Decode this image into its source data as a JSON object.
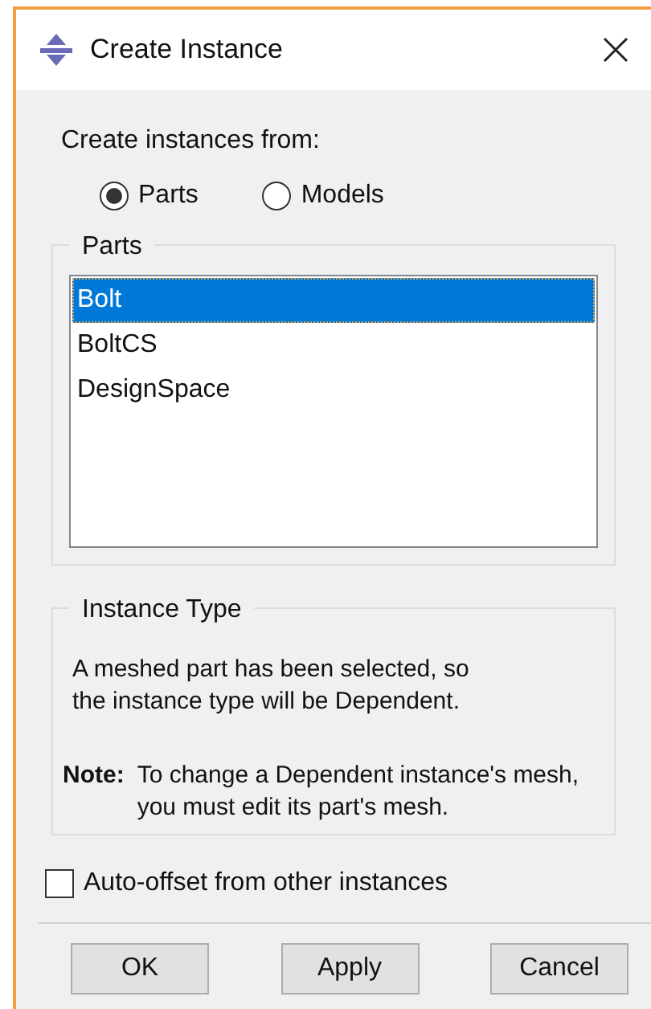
{
  "window": {
    "title": "Create Instance"
  },
  "source": {
    "label": "Create instances from:",
    "options": [
      {
        "label": "Parts",
        "selected": true
      },
      {
        "label": "Models",
        "selected": false
      }
    ]
  },
  "parts": {
    "title": "Parts",
    "items": [
      {
        "label": "Bolt",
        "selected": true
      },
      {
        "label": "BoltCS",
        "selected": false
      },
      {
        "label": "DesignSpace",
        "selected": false
      }
    ]
  },
  "instance_type": {
    "title": "Instance Type",
    "message": "A meshed part has been selected, so the instance type will be Dependent.",
    "note_label": "Note:",
    "note": "To change a Dependent instance's mesh, you must edit its part's mesh."
  },
  "auto_offset": {
    "label": "Auto-offset from other instances",
    "checked": false
  },
  "buttons": [
    "OK",
    "Apply",
    "Cancel"
  ]
}
